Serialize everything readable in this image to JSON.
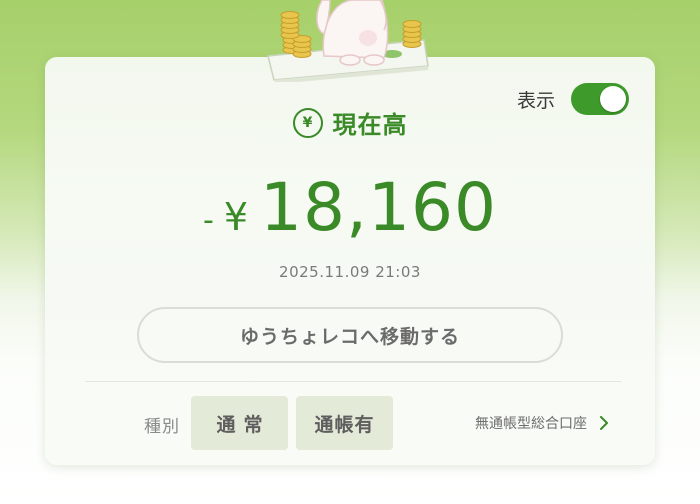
{
  "balance_card": {
    "toggle_label": "表示",
    "toggle_on": true,
    "yen_icon_glyph": "¥",
    "title": "現在高",
    "sign": "-",
    "currency_symbol": "¥",
    "amount": "18,160",
    "timestamp": "2025.11.09 21:03",
    "link_button_label": "ゆうちょレコへ移動する",
    "type_label": "種別",
    "chips": [
      "通常",
      "通帳有"
    ],
    "account_link_label": "無通帳型総合口座"
  },
  "colors": {
    "accent_green": "#3a8a28",
    "toggle_green": "#3e9a2a",
    "chip_bg": "#e4ead8"
  },
  "icons": [
    "yen-icon",
    "chevron-right-icon",
    "mascot-illustration"
  ]
}
